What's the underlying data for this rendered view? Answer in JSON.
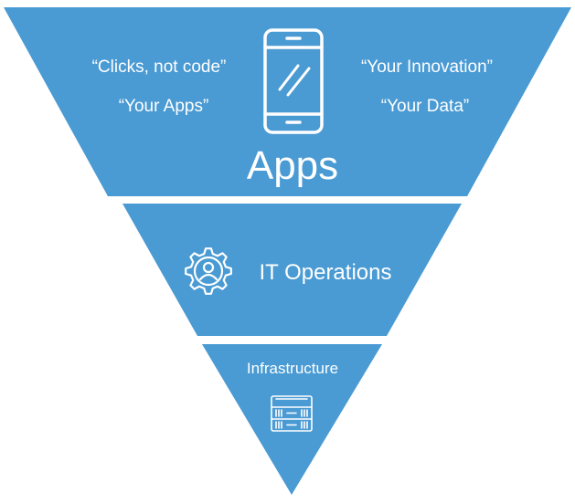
{
  "colors": {
    "fill": "#4a9ad3",
    "text": "#ffffff",
    "background": "#ffffff"
  },
  "tiers": {
    "apps": {
      "title": "Apps",
      "icon": "smartphone-icon",
      "quotes": {
        "top_left": "“Clicks, not code”",
        "bottom_left": "“Your Apps”",
        "top_right": "“Your Innovation”",
        "bottom_right": "“Your Data”"
      }
    },
    "operations": {
      "title": "IT Operations",
      "icon": "gear-user-icon"
    },
    "infrastructure": {
      "title": "Infrastructure",
      "icon": "server-rack-icon"
    }
  }
}
